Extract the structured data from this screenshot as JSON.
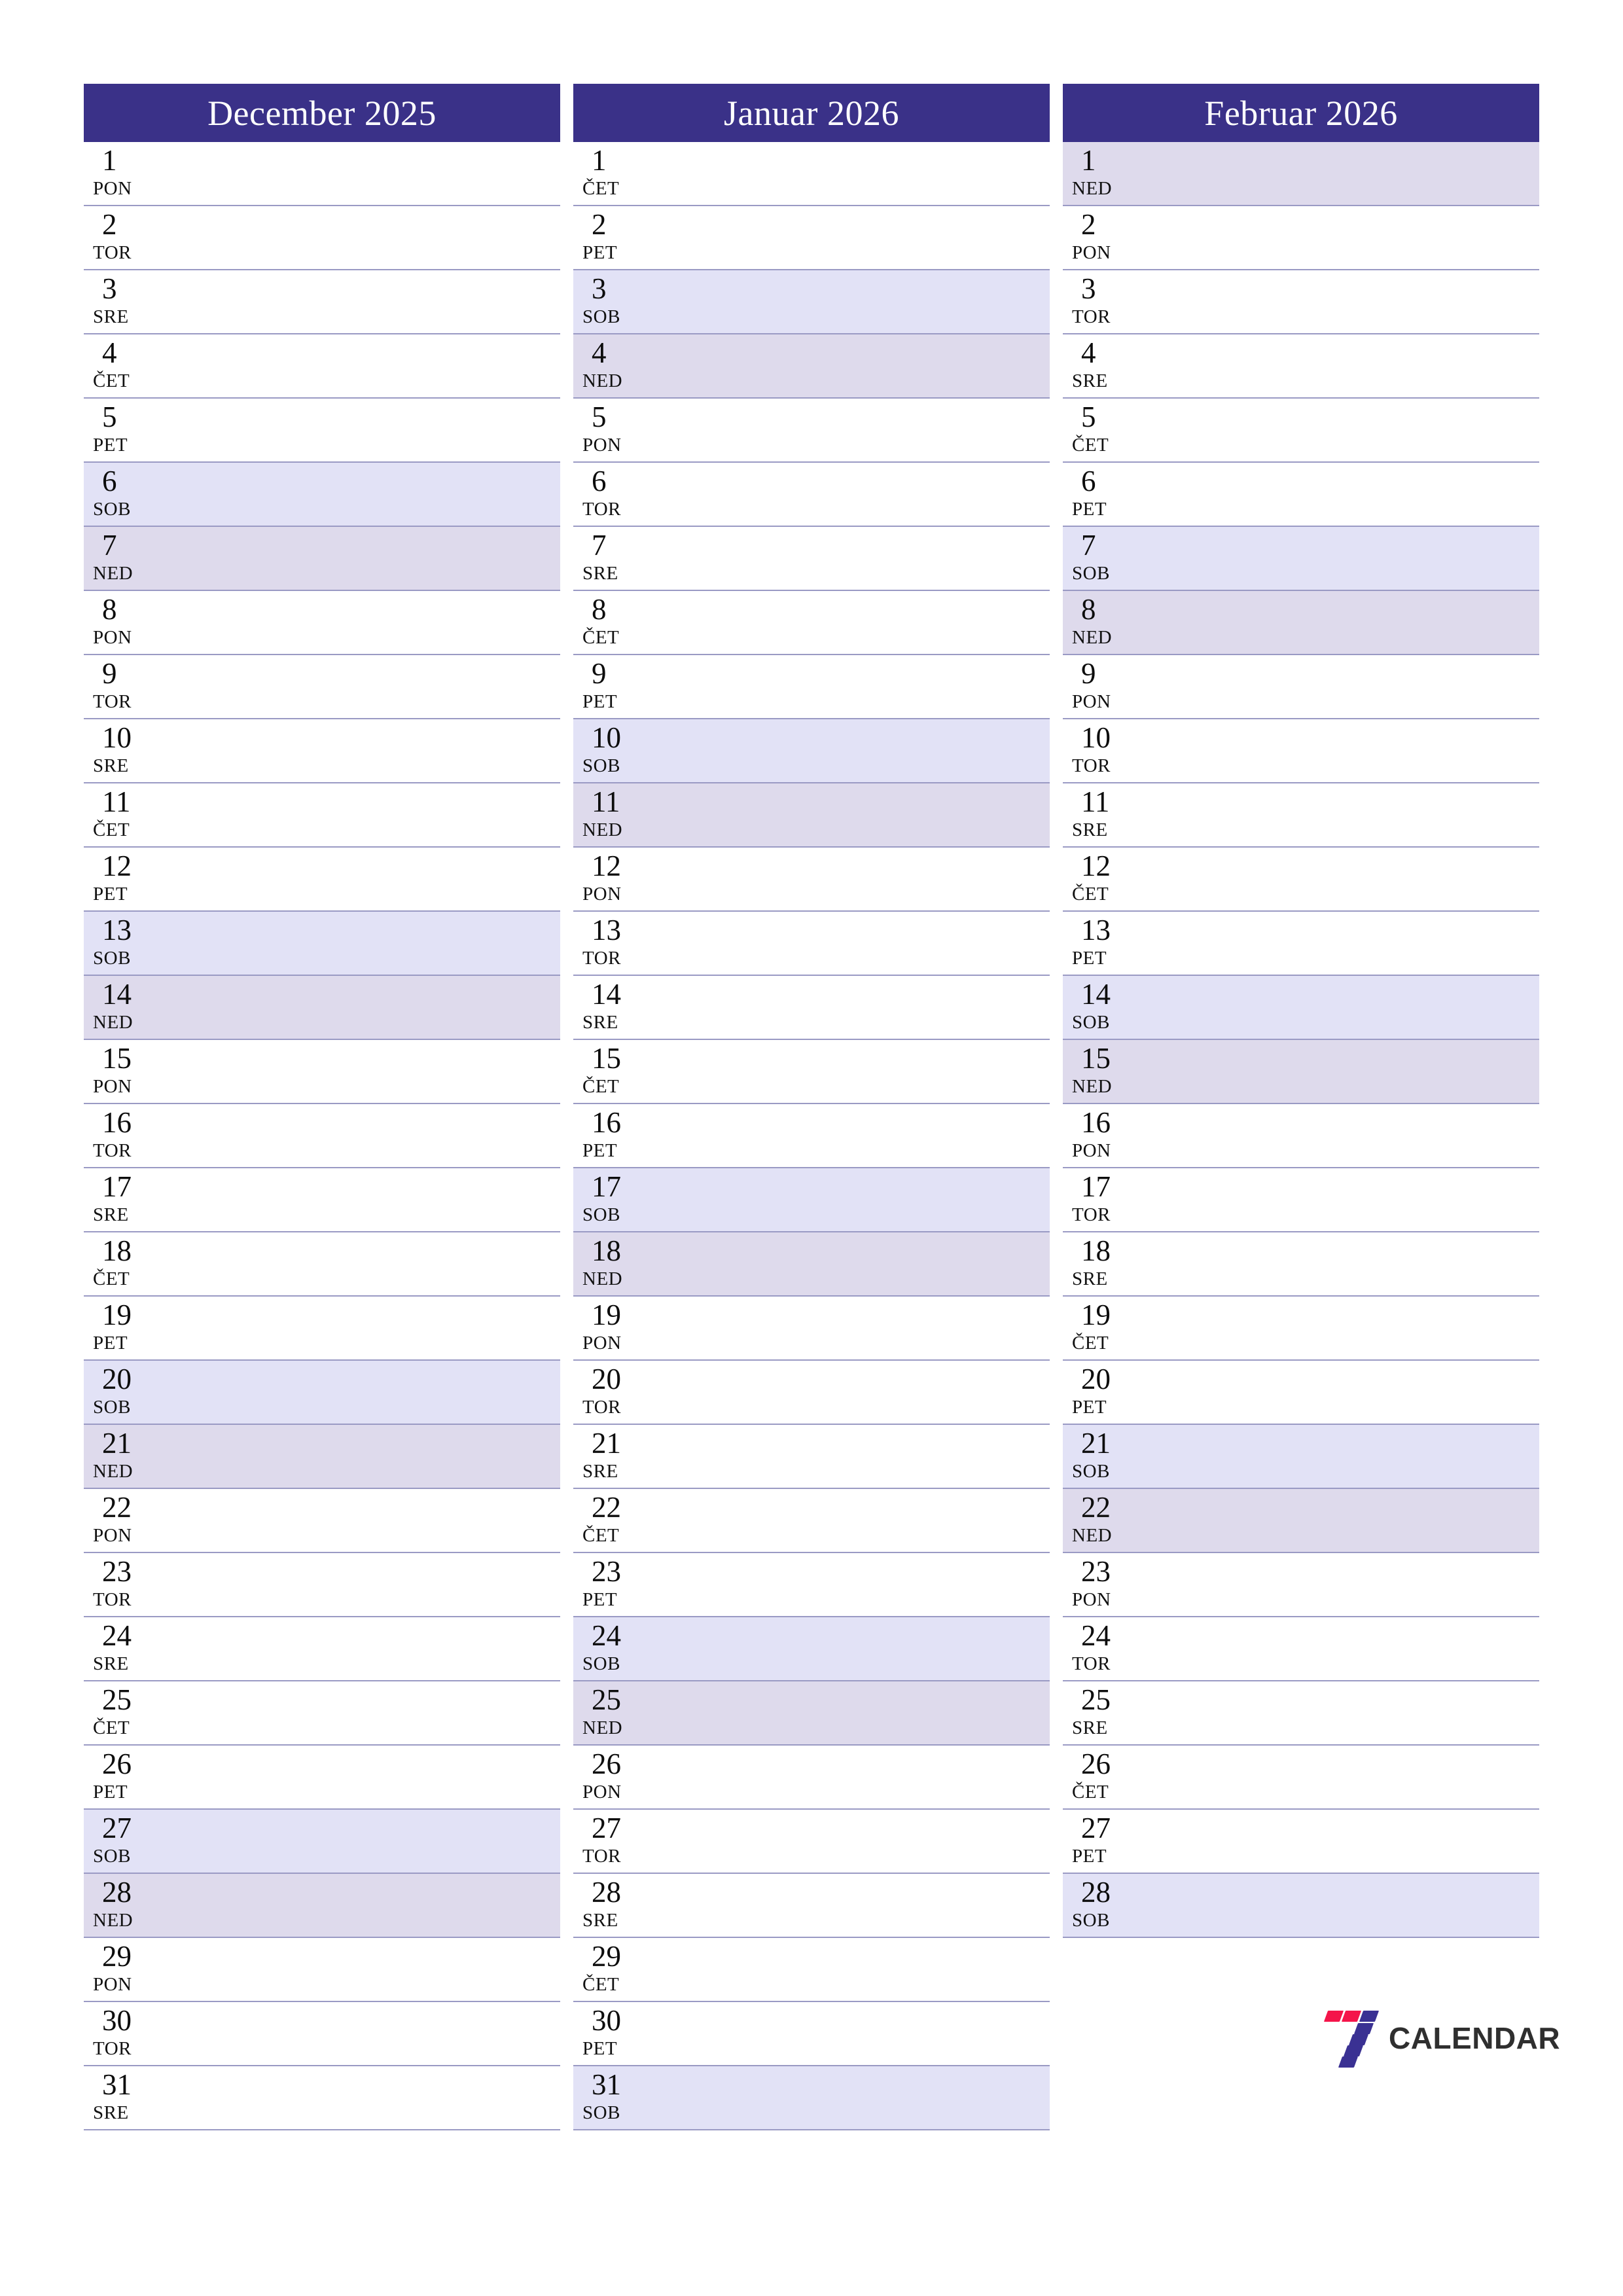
{
  "page": {
    "title": "Three month calendar planner",
    "background_color": "#ffffff",
    "header_color": "#3a3188",
    "saturday_color": "#e2e2f6",
    "sunday_color": "#dedaec",
    "separator_color": "#9a9ac4",
    "day_text_color": "#0d0d0d"
  },
  "brand": {
    "name": "CALENDAR",
    "mark_name": "seven-logo",
    "accent_red": "#f4154a",
    "accent_blue": "#3a3193",
    "text_color": "#2f2f2f"
  },
  "months": [
    {
      "title": "December 2025",
      "days": [
        {
          "num": "1",
          "abbr": "PON",
          "type": "weekday"
        },
        {
          "num": "2",
          "abbr": "TOR",
          "type": "weekday"
        },
        {
          "num": "3",
          "abbr": "SRE",
          "type": "weekday"
        },
        {
          "num": "4",
          "abbr": "ČET",
          "type": "weekday"
        },
        {
          "num": "5",
          "abbr": "PET",
          "type": "weekday"
        },
        {
          "num": "6",
          "abbr": "SOB",
          "type": "sat"
        },
        {
          "num": "7",
          "abbr": "NED",
          "type": "sun"
        },
        {
          "num": "8",
          "abbr": "PON",
          "type": "weekday"
        },
        {
          "num": "9",
          "abbr": "TOR",
          "type": "weekday"
        },
        {
          "num": "10",
          "abbr": "SRE",
          "type": "weekday"
        },
        {
          "num": "11",
          "abbr": "ČET",
          "type": "weekday"
        },
        {
          "num": "12",
          "abbr": "PET",
          "type": "weekday"
        },
        {
          "num": "13",
          "abbr": "SOB",
          "type": "sat"
        },
        {
          "num": "14",
          "abbr": "NED",
          "type": "sun"
        },
        {
          "num": "15",
          "abbr": "PON",
          "type": "weekday"
        },
        {
          "num": "16",
          "abbr": "TOR",
          "type": "weekday"
        },
        {
          "num": "17",
          "abbr": "SRE",
          "type": "weekday"
        },
        {
          "num": "18",
          "abbr": "ČET",
          "type": "weekday"
        },
        {
          "num": "19",
          "abbr": "PET",
          "type": "weekday"
        },
        {
          "num": "20",
          "abbr": "SOB",
          "type": "sat"
        },
        {
          "num": "21",
          "abbr": "NED",
          "type": "sun"
        },
        {
          "num": "22",
          "abbr": "PON",
          "type": "weekday"
        },
        {
          "num": "23",
          "abbr": "TOR",
          "type": "weekday"
        },
        {
          "num": "24",
          "abbr": "SRE",
          "type": "weekday"
        },
        {
          "num": "25",
          "abbr": "ČET",
          "type": "weekday"
        },
        {
          "num": "26",
          "abbr": "PET",
          "type": "weekday"
        },
        {
          "num": "27",
          "abbr": "SOB",
          "type": "sat"
        },
        {
          "num": "28",
          "abbr": "NED",
          "type": "sun"
        },
        {
          "num": "29",
          "abbr": "PON",
          "type": "weekday"
        },
        {
          "num": "30",
          "abbr": "TOR",
          "type": "weekday"
        },
        {
          "num": "31",
          "abbr": "SRE",
          "type": "weekday"
        }
      ]
    },
    {
      "title": "Januar 2026",
      "days": [
        {
          "num": "1",
          "abbr": "ČET",
          "type": "weekday"
        },
        {
          "num": "2",
          "abbr": "PET",
          "type": "weekday"
        },
        {
          "num": "3",
          "abbr": "SOB",
          "type": "sat"
        },
        {
          "num": "4",
          "abbr": "NED",
          "type": "sun"
        },
        {
          "num": "5",
          "abbr": "PON",
          "type": "weekday"
        },
        {
          "num": "6",
          "abbr": "TOR",
          "type": "weekday"
        },
        {
          "num": "7",
          "abbr": "SRE",
          "type": "weekday"
        },
        {
          "num": "8",
          "abbr": "ČET",
          "type": "weekday"
        },
        {
          "num": "9",
          "abbr": "PET",
          "type": "weekday"
        },
        {
          "num": "10",
          "abbr": "SOB",
          "type": "sat"
        },
        {
          "num": "11",
          "abbr": "NED",
          "type": "sun"
        },
        {
          "num": "12",
          "abbr": "PON",
          "type": "weekday"
        },
        {
          "num": "13",
          "abbr": "TOR",
          "type": "weekday"
        },
        {
          "num": "14",
          "abbr": "SRE",
          "type": "weekday"
        },
        {
          "num": "15",
          "abbr": "ČET",
          "type": "weekday"
        },
        {
          "num": "16",
          "abbr": "PET",
          "type": "weekday"
        },
        {
          "num": "17",
          "abbr": "SOB",
          "type": "sat"
        },
        {
          "num": "18",
          "abbr": "NED",
          "type": "sun"
        },
        {
          "num": "19",
          "abbr": "PON",
          "type": "weekday"
        },
        {
          "num": "20",
          "abbr": "TOR",
          "type": "weekday"
        },
        {
          "num": "21",
          "abbr": "SRE",
          "type": "weekday"
        },
        {
          "num": "22",
          "abbr": "ČET",
          "type": "weekday"
        },
        {
          "num": "23",
          "abbr": "PET",
          "type": "weekday"
        },
        {
          "num": "24",
          "abbr": "SOB",
          "type": "sat"
        },
        {
          "num": "25",
          "abbr": "NED",
          "type": "sun"
        },
        {
          "num": "26",
          "abbr": "PON",
          "type": "weekday"
        },
        {
          "num": "27",
          "abbr": "TOR",
          "type": "weekday"
        },
        {
          "num": "28",
          "abbr": "SRE",
          "type": "weekday"
        },
        {
          "num": "29",
          "abbr": "ČET",
          "type": "weekday"
        },
        {
          "num": "30",
          "abbr": "PET",
          "type": "weekday"
        },
        {
          "num": "31",
          "abbr": "SOB",
          "type": "sat"
        }
      ]
    },
    {
      "title": "Februar 2026",
      "days": [
        {
          "num": "1",
          "abbr": "NED",
          "type": "sun"
        },
        {
          "num": "2",
          "abbr": "PON",
          "type": "weekday"
        },
        {
          "num": "3",
          "abbr": "TOR",
          "type": "weekday"
        },
        {
          "num": "4",
          "abbr": "SRE",
          "type": "weekday"
        },
        {
          "num": "5",
          "abbr": "ČET",
          "type": "weekday"
        },
        {
          "num": "6",
          "abbr": "PET",
          "type": "weekday"
        },
        {
          "num": "7",
          "abbr": "SOB",
          "type": "sat"
        },
        {
          "num": "8",
          "abbr": "NED",
          "type": "sun"
        },
        {
          "num": "9",
          "abbr": "PON",
          "type": "weekday"
        },
        {
          "num": "10",
          "abbr": "TOR",
          "type": "weekday"
        },
        {
          "num": "11",
          "abbr": "SRE",
          "type": "weekday"
        },
        {
          "num": "12",
          "abbr": "ČET",
          "type": "weekday"
        },
        {
          "num": "13",
          "abbr": "PET",
          "type": "weekday"
        },
        {
          "num": "14",
          "abbr": "SOB",
          "type": "sat"
        },
        {
          "num": "15",
          "abbr": "NED",
          "type": "sun"
        },
        {
          "num": "16",
          "abbr": "PON",
          "type": "weekday"
        },
        {
          "num": "17",
          "abbr": "TOR",
          "type": "weekday"
        },
        {
          "num": "18",
          "abbr": "SRE",
          "type": "weekday"
        },
        {
          "num": "19",
          "abbr": "ČET",
          "type": "weekday"
        },
        {
          "num": "20",
          "abbr": "PET",
          "type": "weekday"
        },
        {
          "num": "21",
          "abbr": "SOB",
          "type": "sat"
        },
        {
          "num": "22",
          "abbr": "NED",
          "type": "sun"
        },
        {
          "num": "23",
          "abbr": "PON",
          "type": "weekday"
        },
        {
          "num": "24",
          "abbr": "TOR",
          "type": "weekday"
        },
        {
          "num": "25",
          "abbr": "SRE",
          "type": "weekday"
        },
        {
          "num": "26",
          "abbr": "ČET",
          "type": "weekday"
        },
        {
          "num": "27",
          "abbr": "PET",
          "type": "weekday"
        },
        {
          "num": "28",
          "abbr": "SOB",
          "type": "sat"
        }
      ]
    }
  ]
}
